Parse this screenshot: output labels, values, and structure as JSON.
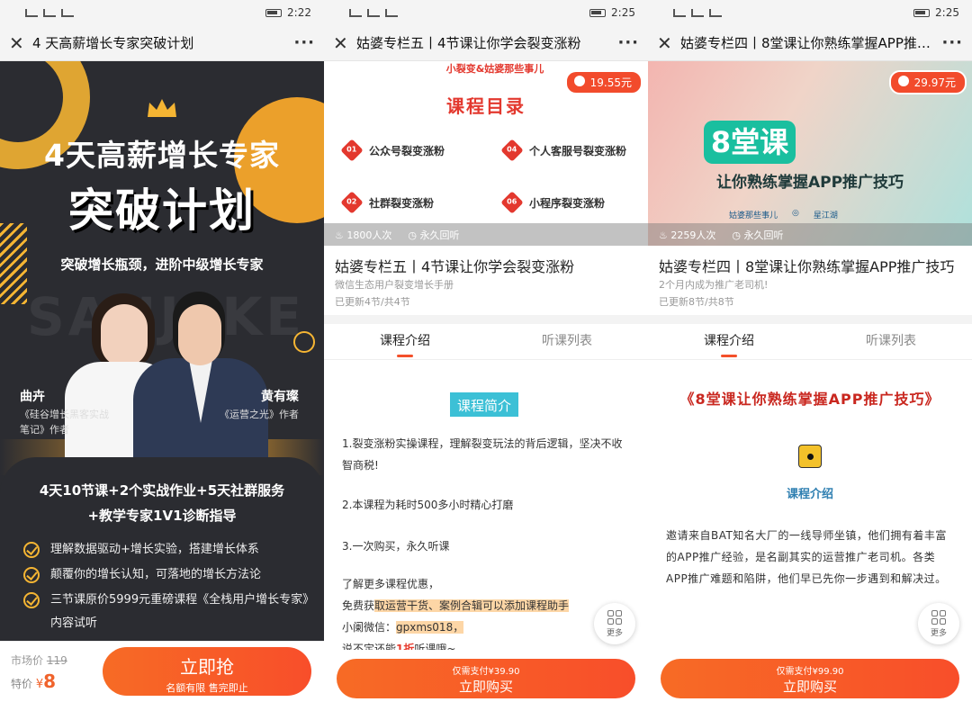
{
  "status": [
    {
      "time": "2:22"
    },
    {
      "time": "2:25"
    },
    {
      "time": "2:25"
    }
  ],
  "panel1": {
    "nav_title": "4 天高薪增长专家突破计划",
    "poster": {
      "title_line1": "4天高薪增长专家",
      "title_line2": "突破计划",
      "subtitle": "突破增长瓶颈，进阶中级增长专家",
      "watermark": "SANJEKE",
      "teacher1_name": "曲卉",
      "teacher1_desc": "《硅谷增长黑客实战笔记》作者",
      "teacher2_name": "黄有璨",
      "teacher2_desc": "《运营之光》作者",
      "feature_line1": "4天10节课+2个实战作业+5天社群服务",
      "feature_line2": "+教学专家1V1诊断指导",
      "bullets": [
        "理解数据驱动+增长实验，搭建增长体系",
        "颠覆你的增长认知，可落地的增长方法论",
        "三节课原价5999元重磅课程《全栈用户增长专家》内容试听"
      ]
    },
    "market_price_label": "市场价",
    "market_price": "119",
    "special_label": "特价",
    "currency": "¥",
    "special_price": "8",
    "grab_button": "立即抢",
    "grab_sub": "名额有限 售完即止"
  },
  "panel2": {
    "nav_title": "姑婆专栏五丨4节课让你学会裂变涨粉",
    "banner": {
      "top_text": "小裂变&姑婆那些事儿",
      "directory": "课程目录",
      "items": [
        {
          "num": "01",
          "label": "公众号裂变涨粉"
        },
        {
          "num": "04",
          "label": "个人客服号裂变涨粉"
        },
        {
          "num": "02",
          "label": "社群裂变涨粉"
        },
        {
          "num": "06",
          "label": "小程序裂变涨粉"
        }
      ]
    },
    "price": "19.55元",
    "learners": "1800人次",
    "forever": "永久回听",
    "title": "姑婆专栏五丨4节课让你学会裂变涨粉",
    "sub": "微信生态用户裂变增长手册",
    "updated": "已更新4节/共4节",
    "tab_intro": "课程介绍",
    "tab_list": "听课列表",
    "intro_tag": "课程简介",
    "para1": "1.裂变涨粉实操课程，理解裂变玩法的背后逻辑，坚决不收智商税!",
    "para2": "2.本课程为耗时500多小时精心打磨",
    "para3": "3.一次购买，永久听课",
    "para4": "了解更多课程优惠，",
    "para5a": "免费获",
    "para5b": "取运营干货、案例合辑可以添加课程助手",
    "para6a": "小阑微信：",
    "para6b": "gpxms018，",
    "para7a": "说不定还能",
    "para7b": "1折",
    "para7c": "听课哦~",
    "more": "更多",
    "buy_sub": "仅需支付¥39.90",
    "buy_label": "立即购买"
  },
  "panel3": {
    "nav_title": "姑婆专栏四丨8堂课让你熟练掌握APP推广...",
    "banner": {
      "tag": "8堂课",
      "line": "让你熟练掌握APP推广技巧",
      "logo1": "姑婆那些事儿",
      "logo3": "星江湖"
    },
    "price": "29.97元",
    "learners": "2259人次",
    "forever": "永久回听",
    "title": "姑婆专栏四丨8堂课让你熟练掌握APP推广技巧",
    "sub": "2个月内成为推广老司机!",
    "updated": "已更新8节/共8节",
    "tab_intro": "课程介绍",
    "tab_list": "听课列表",
    "heading": "《8堂课让你熟练掌握APP推广技巧》",
    "sub_heading": "课程介绍",
    "body": "邀请来自BAT知名大厂的一线导师坐镇，他们拥有着丰富的APP推广经验，是名副其实的运营推广老司机。各类APP推广难题和陷阱，他们早已先你一步遇到和解决过。",
    "more": "更多",
    "buy_sub": "仅需支付¥99.90",
    "buy_label": "立即购买"
  }
}
